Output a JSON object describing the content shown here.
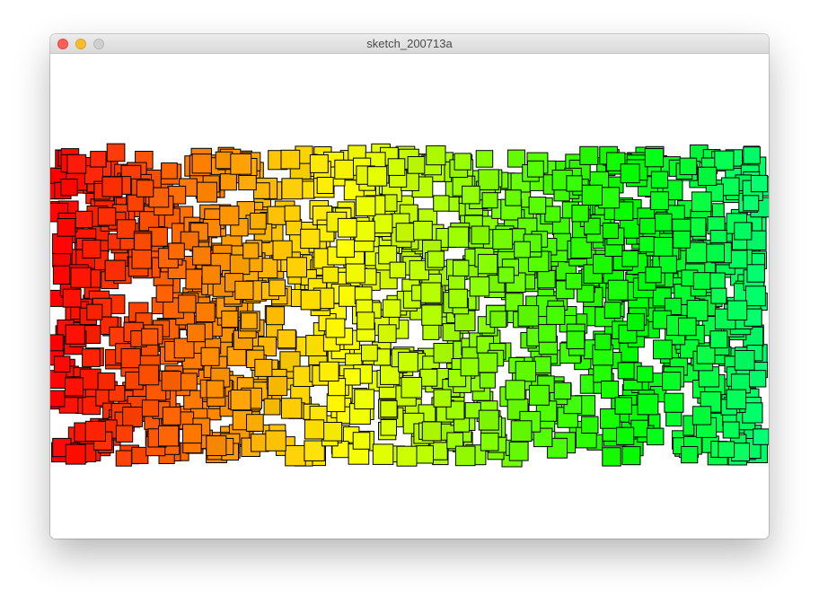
{
  "window": {
    "title": "sketch_200713a"
  },
  "titlebar": {
    "buttons": [
      {
        "name": "close-button",
        "color": "#fc5f57"
      },
      {
        "name": "minimize-button",
        "color": "#fdbc2e"
      },
      {
        "name": "zoom-button",
        "color": "#d0d0d0"
      }
    ]
  },
  "sketch": {
    "background": "#ffffff",
    "shape": "square",
    "stroke": "#000000",
    "fill_gradient": [
      "#ff0000",
      "#ff8000",
      "#ffff00",
      "#80ff00",
      "#00ff00",
      "#00ff66"
    ]
  }
}
